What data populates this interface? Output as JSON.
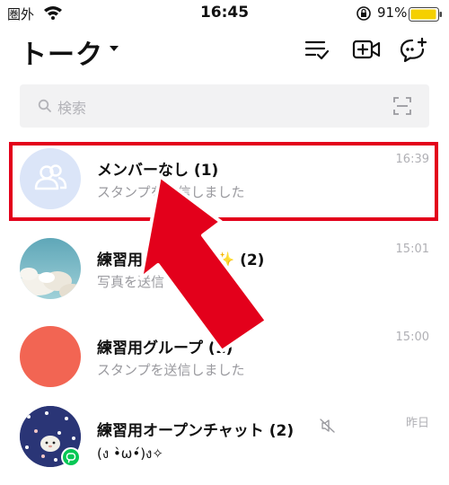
{
  "status_bar": {
    "carrier": "圏外",
    "time": "16:45",
    "battery": "91%"
  },
  "header": {
    "title": "トーク"
  },
  "search": {
    "placeholder": "検索"
  },
  "chats": [
    {
      "name": "メンバーなし  (1)",
      "message": "スタンプを送信しました",
      "time": "16:39"
    },
    {
      "name": "練習用グ",
      "name_suffix": "✨  (2)",
      "message": "写真を送信",
      "time": "15:01"
    },
    {
      "name": "練習用グループ",
      "name_suffix": "(1)",
      "message": "スタンプを送信しました",
      "time": "15:00"
    },
    {
      "name": "練習用オープンチャット  (2)",
      "message": "(ง •̀ω•́)ง✧",
      "time": "昨日"
    }
  ],
  "colors": {
    "highlight": "#e3001b",
    "arrow": "#e3001b",
    "battery": "#f5d000",
    "openchat_badge": "#06c755"
  }
}
